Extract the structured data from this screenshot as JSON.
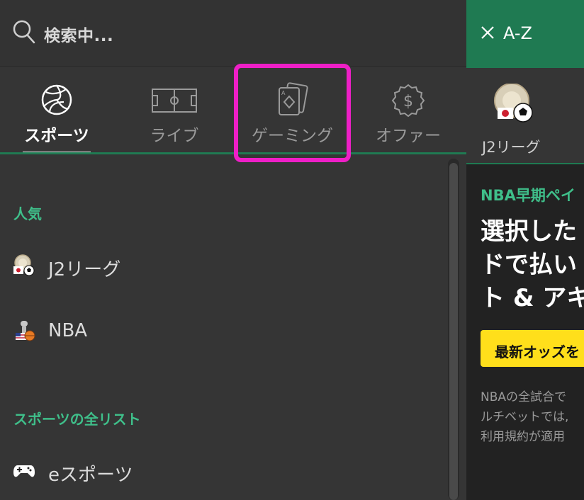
{
  "search": {
    "placeholder": "検索中..."
  },
  "tabs": [
    {
      "label": "スポーツ",
      "icon": "volleyball-icon",
      "active": true
    },
    {
      "label": "ライブ",
      "icon": "soccer-field-icon",
      "active": false
    },
    {
      "label": "ゲーミング",
      "icon": "playing-cards-icon",
      "active": false
    },
    {
      "label": "オファー",
      "icon": "dollar-badge-icon",
      "active": false
    }
  ],
  "sections": {
    "popular": {
      "title": "人気",
      "items": [
        {
          "label": "J2リーグ",
          "icon": "j2-league-icon"
        },
        {
          "label": "NBA",
          "icon": "nba-icon"
        }
      ]
    },
    "all_sports": {
      "title": "スポーツの全リスト",
      "items": [
        {
          "label": "eスポーツ",
          "icon": "gamepad-icon"
        }
      ]
    }
  },
  "az_panel": {
    "title": "A-Z",
    "featured": {
      "label": "J2リーグ",
      "icon": "j2-league-icon"
    },
    "promo": {
      "kicker": "NBA早期ペイ",
      "headline": [
        "選択した",
        "ドで払い",
        "ト & アキ"
      ],
      "button": "最新オッズを",
      "small_lines": [
        "NBAの全試合で",
        "ルチベットでは,",
        "利用規約が適用"
      ]
    }
  },
  "colors": {
    "accent_green": "#1f7a52",
    "section_green": "#3fbf8a",
    "highlight_magenta": "#ee1fc7",
    "promo_yellow": "#ffdf1b"
  }
}
